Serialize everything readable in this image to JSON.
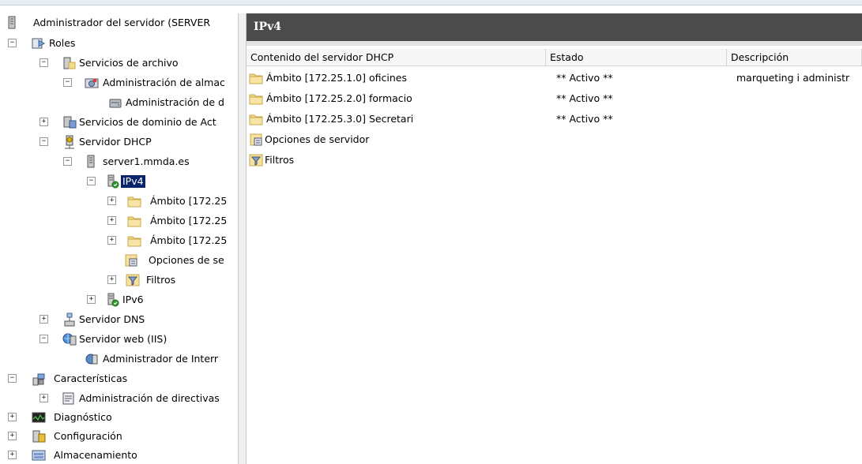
{
  "tree": {
    "root": "Administrador del servidor (SERVER",
    "roles": "Roles",
    "file_services": "Servicios de archivo",
    "storage_admin": "Administración de almac",
    "storage_admin_child": "Administración de d",
    "domain_services": "Servicios de dominio de Act",
    "dhcp_server": "Servidor DHCP",
    "server1": "server1.mmda.es",
    "ipv4": "IPv4",
    "scope1": "Ámbito [172.25",
    "scope2": "Ámbito [172.25",
    "scope3": "Ámbito [172.25",
    "server_options": "Opciones de se",
    "filters": "Filtros",
    "ipv6": "IPv6",
    "dns_server": "Servidor DNS",
    "web_server": "Servidor web (IIS)",
    "iis_manager": "Administrador de Interr",
    "features": "Características",
    "policy_admin": "Administración de directivas",
    "diagnostics": "Diagnóstico",
    "configuration": "Configuración",
    "storage": "Almacenamiento"
  },
  "header": {
    "title": "IPv4"
  },
  "list": {
    "columns": [
      "Contenido del servidor DHCP",
      "Estado",
      "Descripción"
    ],
    "rows": [
      {
        "name": "Ámbito [172.25.1.0] oficines",
        "status": "** Activo **",
        "description": "marqueting i administr",
        "icon": "folder-icon"
      },
      {
        "name": "Ámbito [172.25.2.0] formacio",
        "status": "** Activo **",
        "description": "",
        "icon": "folder-icon"
      },
      {
        "name": "Ámbito [172.25.3.0] Secretari",
        "status": "** Activo **",
        "description": "",
        "icon": "folder-icon"
      },
      {
        "name": "Opciones de servidor",
        "status": "",
        "description": "",
        "icon": "server-options-icon"
      },
      {
        "name": "Filtros",
        "status": "",
        "description": "",
        "icon": "filter-icon"
      }
    ]
  },
  "colors": {
    "selection": "#0a246a",
    "header_bar": "#4b4b4b",
    "folder": "#f3d98a"
  }
}
